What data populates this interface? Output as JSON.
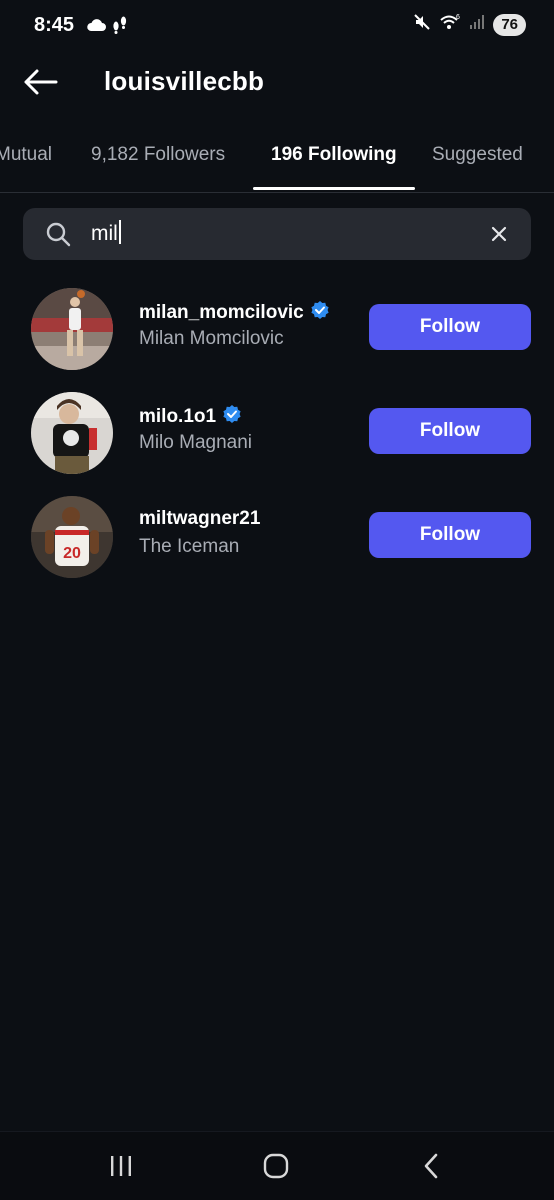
{
  "status_bar": {
    "time": "8:45",
    "battery": "76",
    "icons": [
      "cloud-icon",
      "footsteps-icon",
      "mute-icon",
      "wifi-icon",
      "signal-icon",
      "battery-icon"
    ]
  },
  "header": {
    "title": "louisvillecbb",
    "back_icon": "arrow-left-icon"
  },
  "tabs": [
    {
      "label": "Mutual",
      "active": false
    },
    {
      "label": "9,182 Followers",
      "active": false
    },
    {
      "label": "196 Following",
      "active": true
    },
    {
      "label": "Suggested",
      "active": false
    }
  ],
  "search": {
    "value": "mil",
    "icon": "search-icon",
    "clear_icon": "close-icon"
  },
  "results": [
    {
      "username": "milan_momcilovic",
      "display_name": "Milan Momcilovic",
      "verified": true,
      "button": "Follow"
    },
    {
      "username": "milo.1o1",
      "display_name": "Milo Magnani",
      "verified": true,
      "button": "Follow"
    },
    {
      "username": "miltwagner21",
      "display_name": "The Iceman",
      "verified": false,
      "button": "Follow"
    }
  ],
  "nav": {
    "icons": [
      "recents-icon",
      "home-icon",
      "back-icon"
    ]
  },
  "colors": {
    "background": "#0c0f14",
    "accent": "#5458f0",
    "verified": "#2f8cf0",
    "muted_text": "#a9adb5"
  }
}
